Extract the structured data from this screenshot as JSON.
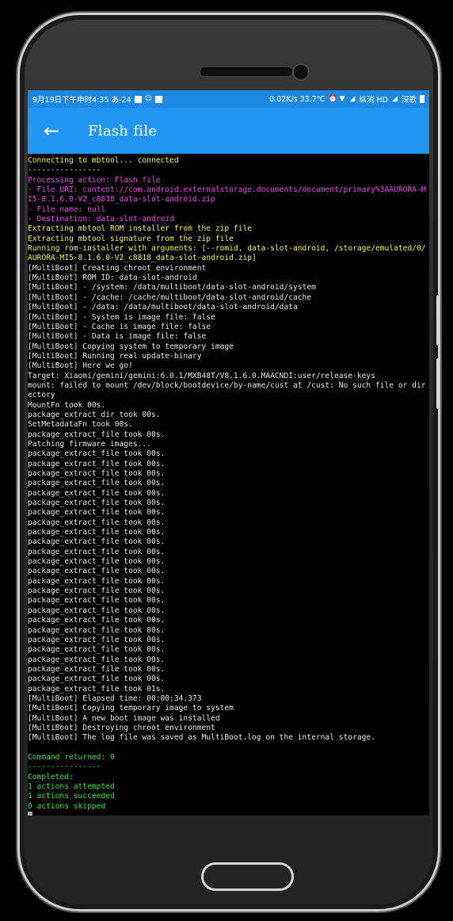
{
  "status_bar": {
    "left_text": "9月19日下午申时4:35 あ-24",
    "right_text": "0.02K/s 33.7℃",
    "carrier": "纵消 HD",
    "carrier2": "深歌"
  },
  "app_bar": {
    "back_icon": "arrow-left-icon",
    "title": "Flash file"
  },
  "log_lines": [
    {
      "text": "Connecting to mbtool... connected",
      "color": "yellow"
    },
    {
      "text": "----------------",
      "color": "yellow"
    },
    {
      "text": "Processing action: Flash file",
      "color": "magenta"
    },
    {
      "text": "- File URI: content://com.android.externalstorage.documents/document/primary%3AAURORA-MI5-8.1.6.0-V2_c8818_data-slot-android.zip",
      "color": "magenta"
    },
    {
      "text": "- File name: null",
      "color": "magenta"
    },
    {
      "text": "- Destination: data-slot-android",
      "color": "magenta"
    },
    {
      "text": "Extracting mbtool ROM installer from the zip file",
      "color": "yellow"
    },
    {
      "text": "Extracting mbtool signature from the zip file",
      "color": "yellow"
    },
    {
      "text": "Running rom-installer with arguments: [--romid, data-slot-android, /storage/emulated/0/AURORA-MI5-8.1.6.0-V2_c8818_data-slot-android.zip]",
      "color": "yellow"
    },
    {
      "text": "[MultiBoot] Creating chroot environment",
      "color": "gray"
    },
    {
      "text": "[MultiBoot] ROM ID: data-slot-android",
      "color": "gray"
    },
    {
      "text": "[MultiBoot] - /system: /data/multiboot/data-slot-android/system",
      "color": "gray"
    },
    {
      "text": "[MultiBoot] - /cache: /cache/multiboot/data-slot-android/cache",
      "color": "gray"
    },
    {
      "text": "[MultiBoot] - /data: /data/multiboot/data-slot-android/data",
      "color": "gray"
    },
    {
      "text": "[MultiBoot] - System is image file: false",
      "color": "gray"
    },
    {
      "text": "[MultiBoot] - Cache is image file: false",
      "color": "gray"
    },
    {
      "text": "[MultiBoot] - Data is image file: false",
      "color": "gray"
    },
    {
      "text": "[MultiBoot] Copying system to temporary image",
      "color": "gray"
    },
    {
      "text": "[MultiBoot] Running real update-binary",
      "color": "gray"
    },
    {
      "text": "[MultiBoot] Here we go!",
      "color": "gray"
    },
    {
      "text": "Target: Xiaomi/gemini/gemini:6.0.1/MXB48T/V8.1.6.0.MAACNDI:user/release-keys",
      "color": "gray"
    },
    {
      "text": "mount: failed to mount /dev/block/bootdevice/by-name/cust at /cust: No such file or directory",
      "color": "gray"
    },
    {
      "text": "MountFn took 00s.",
      "color": "gray"
    },
    {
      "text": "package_extract_dir took 00s.",
      "color": "gray"
    },
    {
      "text": "SetMetadataFn took 00s.",
      "color": "gray"
    },
    {
      "text": "package_extract_file took 00s.",
      "color": "gray"
    },
    {
      "text": "Patching firmware images...",
      "color": "gray"
    },
    {
      "text": "package_extract_file took 00s.",
      "color": "gray"
    },
    {
      "text": "package_extract_file took 00s.",
      "color": "gray"
    },
    {
      "text": "package_extract_file took 00s.",
      "color": "gray"
    },
    {
      "text": "package_extract_file took 00s.",
      "color": "gray"
    },
    {
      "text": "package_extract_file took 00s.",
      "color": "gray"
    },
    {
      "text": "package_extract_file took 00s.",
      "color": "gray"
    },
    {
      "text": "package_extract_file took 00s.",
      "color": "gray"
    },
    {
      "text": "package_extract_file took 00s.",
      "color": "gray"
    },
    {
      "text": "package_extract_file took 00s.",
      "color": "gray"
    },
    {
      "text": "package_extract_file took 00s.",
      "color": "gray"
    },
    {
      "text": "package_extract_file took 00s.",
      "color": "gray"
    },
    {
      "text": "package_extract_file took 00s.",
      "color": "gray"
    },
    {
      "text": "package_extract_file took 00s.",
      "color": "gray"
    },
    {
      "text": "package_extract_file took 00s.",
      "color": "gray"
    },
    {
      "text": "package_extract_file took 00s.",
      "color": "gray"
    },
    {
      "text": "package_extract_file took 00s.",
      "color": "gray"
    },
    {
      "text": "package_extract_file took 00s.",
      "color": "gray"
    },
    {
      "text": "package_extract_file took 00s.",
      "color": "gray"
    },
    {
      "text": "package_extract_file took 00s.",
      "color": "gray"
    },
    {
      "text": "package_extract_file took 00s.",
      "color": "gray"
    },
    {
      "text": "package_extract_file took 00s.",
      "color": "gray"
    },
    {
      "text": "package_extract_file took 00s.",
      "color": "gray"
    },
    {
      "text": "package_extract_file took 00s.",
      "color": "gray"
    },
    {
      "text": "package_extract_file took 00s.",
      "color": "gray"
    },
    {
      "text": "package_extract_file took 01s.",
      "color": "gray"
    },
    {
      "text": "[MultiBoot] Elapsed time: 00:00:34.373",
      "color": "gray"
    },
    {
      "text": "[MultiBoot] Copying temporary image to system",
      "color": "gray"
    },
    {
      "text": "[MultiBoot] A new boot image was installed",
      "color": "gray"
    },
    {
      "text": "[MultiBoot] Destroying chroot environment",
      "color": "gray"
    },
    {
      "text": "[MultiBoot] The log file was saved as MultiBoot.log on the internal storage.",
      "color": "gray"
    },
    {
      "text": "",
      "color": "gray"
    },
    {
      "text": "Command returned: 0",
      "color": "green"
    },
    {
      "text": "----------------",
      "color": "green"
    },
    {
      "text": "Completed:",
      "color": "green"
    },
    {
      "text": "1 actions attempted",
      "color": "green"
    },
    {
      "text": "1 actions succeeded",
      "color": "green"
    },
    {
      "text": "0 actions skipped",
      "color": "green"
    }
  ],
  "colors": {
    "status_bar": "#1e88e5",
    "app_bar": "#2196f3",
    "yellow": "#f5f53c",
    "magenta": "#f040f0",
    "gray": "#e6e6e6",
    "green": "#33e33a"
  }
}
